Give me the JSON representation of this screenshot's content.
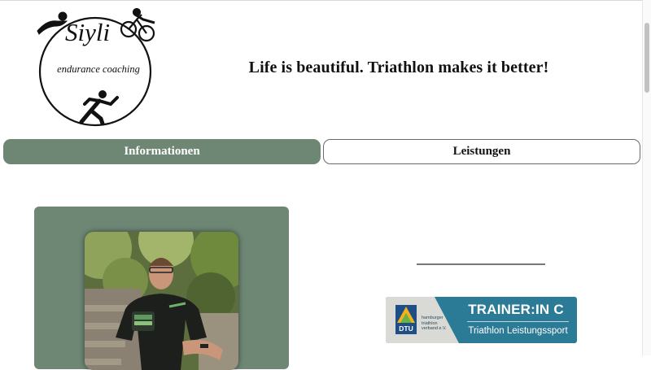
{
  "brand": {
    "name": "Siyli",
    "subtitle": "endurance coaching"
  },
  "header": {
    "tagline": "Life is beautiful. Triathlon makes it better!"
  },
  "nav": {
    "tabs": [
      {
        "label": "Informationen",
        "active": true
      },
      {
        "label": "Leistungen",
        "active": false
      }
    ]
  },
  "colors": {
    "accent": "#6e8775",
    "badge": "#2b7a96"
  },
  "badge": {
    "org_lines": [
      "hamburger",
      "triathlon",
      "verband e.V."
    ],
    "logo_text": "DTU",
    "title": "TRAINER:IN C",
    "subtitle": "Triathlon Leistungssport"
  }
}
